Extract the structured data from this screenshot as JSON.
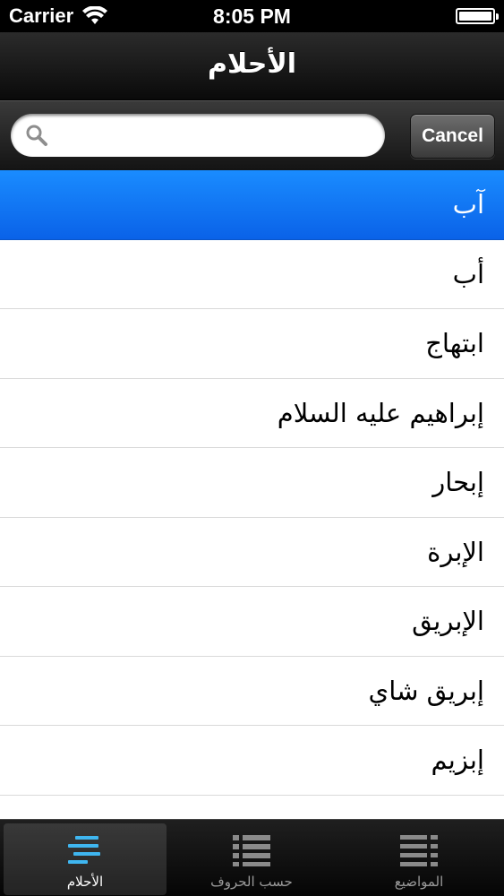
{
  "status_bar": {
    "carrier": "Carrier",
    "time": "8:05 PM",
    "battery_level": 1.0
  },
  "nav": {
    "title": "الأحلام"
  },
  "search": {
    "value": "",
    "placeholder": "",
    "cancel_label": "Cancel"
  },
  "list": {
    "items": [
      {
        "label": "آب",
        "selected": true
      },
      {
        "label": "أب",
        "selected": false
      },
      {
        "label": "ابتهاج",
        "selected": false
      },
      {
        "label": "إبراهيم عليه السلام",
        "selected": false
      },
      {
        "label": "إبحار",
        "selected": false
      },
      {
        "label": "الإبرة",
        "selected": false
      },
      {
        "label": "الإبريق",
        "selected": false
      },
      {
        "label": "إبريق شاي",
        "selected": false
      },
      {
        "label": "إبزيم",
        "selected": false
      }
    ]
  },
  "tabs": [
    {
      "label": "الأحلام",
      "icon": "dreams-list-icon",
      "active": true
    },
    {
      "label": "حسب الحروف",
      "icon": "bulleted-list-icon",
      "active": false
    },
    {
      "label": "المواضيع",
      "icon": "topics-list-icon",
      "active": false
    }
  ],
  "colors": {
    "selection_blue": "#0a6cf0",
    "active_tab_icon": "#3fb6f0",
    "inactive_tab": "#8a8a8a"
  }
}
